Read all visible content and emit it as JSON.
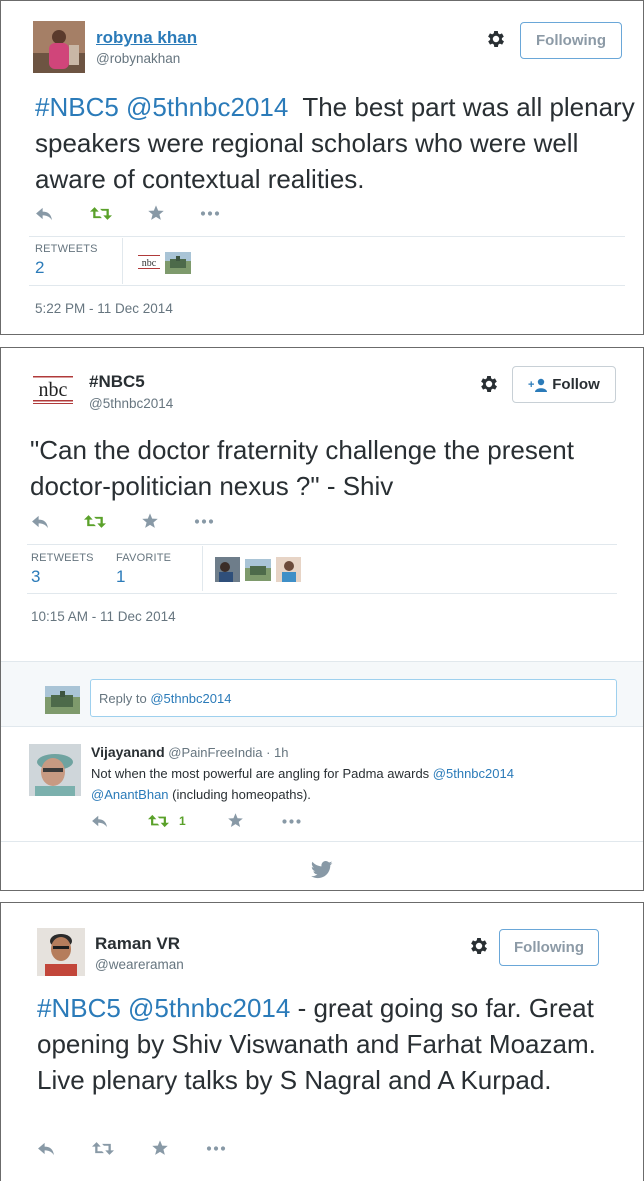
{
  "tweets": [
    {
      "author_name": "robyna khan",
      "author_handle": "@robynakhan",
      "follow_label": "Following",
      "text_hashtags": "#NBC5 @5thnbc2014",
      "text_body": "The best part was all plenary speakers were regional scholars who were well aware of contextual realities.",
      "stats": [
        {
          "label": "RETWEETS",
          "value": "2"
        }
      ],
      "retweeter_avatar_logo": "nbc",
      "timestamp": "5:22 PM - 11 Dec 2014"
    },
    {
      "author_name": "#NBC5",
      "author_handle": "@5thnbc2014",
      "avatar_logo": "nbc",
      "follow_label": "Follow",
      "text_body": "\"Can the doctor fraternity challenge the present doctor-politician nexus ?\" - Shiv",
      "stats": [
        {
          "label": "RETWEETS",
          "value": "3"
        },
        {
          "label": "FAVORITE",
          "value": "1"
        }
      ],
      "timestamp": "10:15 AM - 11 Dec 2014",
      "reply_prefix": "Reply to ",
      "reply_target": "@5thnbc2014",
      "replies": [
        {
          "author_name": "Vijayanand",
          "author_handle": "@PainFreeIndia",
          "age": "· 1h",
          "text_plain": "Not when the most powerful are angling for Padma awards ",
          "text_mention1": "@5thnbc2014",
          "text_mention2": "@AnantBhan",
          "text_tail": " (including homeopaths).",
          "retweet_count": "1"
        }
      ]
    },
    {
      "author_name": "Raman VR",
      "author_handle": "@weareraman",
      "follow_label": "Following",
      "text_hashtags": "#NBC5 @5thnbc2014",
      "text_body": " - great going so far. Great opening by Shiv Viswanath and Farhat Moazam. Live plenary talks by S Nagral and A Kurpad."
    }
  ],
  "colors": {
    "link": "#2b7bb9",
    "retweet_green": "#5aa12a",
    "icon_gray": "#8899a6"
  },
  "icons": [
    "gear-icon",
    "reply-icon",
    "retweet-icon",
    "favorite-icon",
    "more-icon",
    "follow-person-icon",
    "twitter-bird-icon"
  ]
}
